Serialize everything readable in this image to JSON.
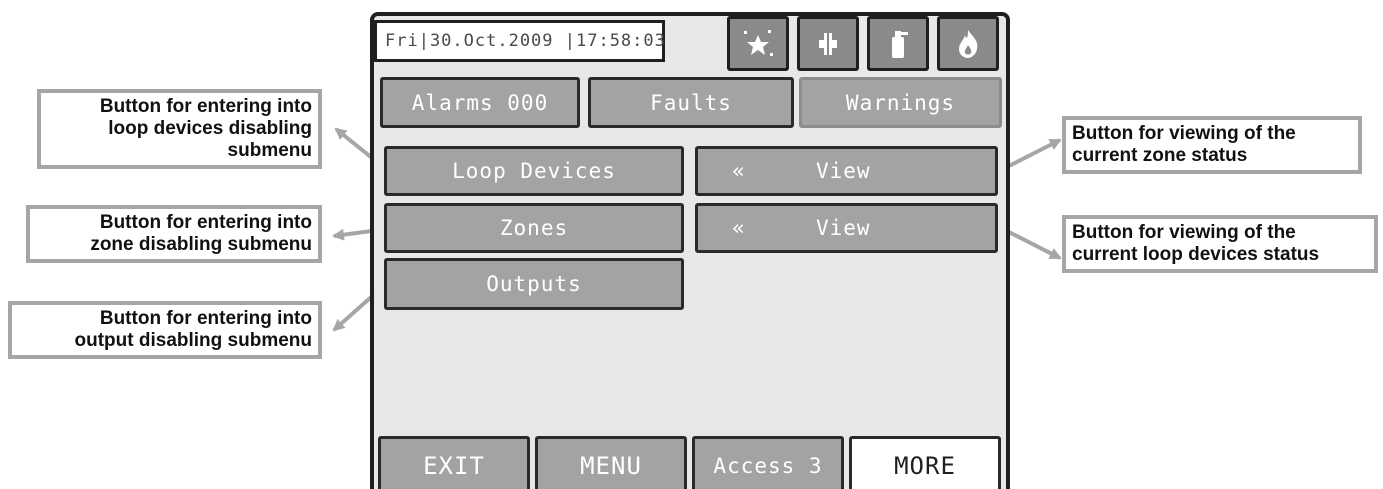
{
  "header": {
    "datetime": "Fri|30.Oct.2009 |17:58:03",
    "status_icons": [
      "sparkle-star-icon",
      "speaker-icon",
      "extinguisher-icon",
      "fire-icon"
    ]
  },
  "tabs": {
    "alarms": "Alarms 000",
    "faults": "Faults",
    "warnings": "Warnings"
  },
  "menu": {
    "loop_devices": "Loop Devices",
    "zones": "Zones",
    "outputs": "Outputs",
    "view_chevron": "«",
    "view_label": "View"
  },
  "bottom_bar": {
    "exit": "EXIT",
    "menu": "MENU",
    "access": "Access 3",
    "more": "MORE"
  },
  "callouts": {
    "loop_devices": [
      "Button for entering into",
      "loop devices disabling",
      "submenu"
    ],
    "zones": [
      "Button for entering into",
      "zone disabling submenu"
    ],
    "outputs": [
      "Button for entering into",
      "output disabling submenu"
    ],
    "zone_view": [
      "Button for viewing of the",
      "current zone status"
    ],
    "loop_view": [
      "Button for viewing of the",
      "current loop devices status"
    ]
  },
  "colors": {
    "button_fill": "#a3a3a3",
    "panel_bg": "#e8e8e8",
    "border": "#1f1f1f",
    "callout_border": "#a6a6a6"
  }
}
